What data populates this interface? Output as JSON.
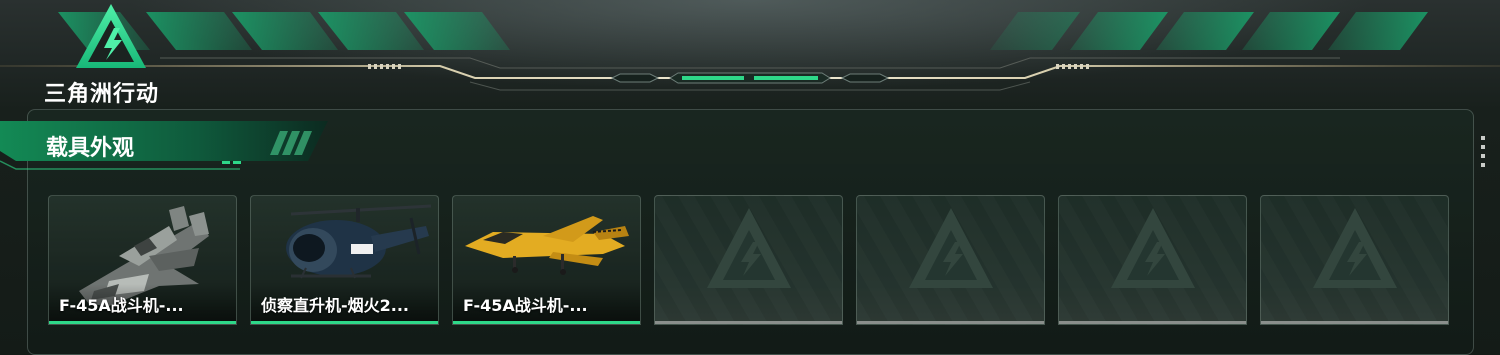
{
  "brand": {
    "logo_text": "三角洲行动",
    "accent_color": "#2ed889"
  },
  "section": {
    "title": "载具外观"
  },
  "vehicles": [
    {
      "label": "F-45A战斗机-...",
      "icon": "camo-jet-icon",
      "state": "filled"
    },
    {
      "label": "侦察直升机-烟火2...",
      "icon": "helicopter-icon",
      "state": "filled"
    },
    {
      "label": "F-45A战斗机-...",
      "icon": "yellow-jet-icon",
      "state": "filled"
    },
    {
      "label": "",
      "icon": "delta-placeholder-icon",
      "state": "empty"
    },
    {
      "label": "",
      "icon": "delta-placeholder-icon",
      "state": "empty"
    },
    {
      "label": "",
      "icon": "delta-placeholder-icon",
      "state": "empty"
    },
    {
      "label": "",
      "icon": "delta-placeholder-icon",
      "state": "empty"
    }
  ]
}
